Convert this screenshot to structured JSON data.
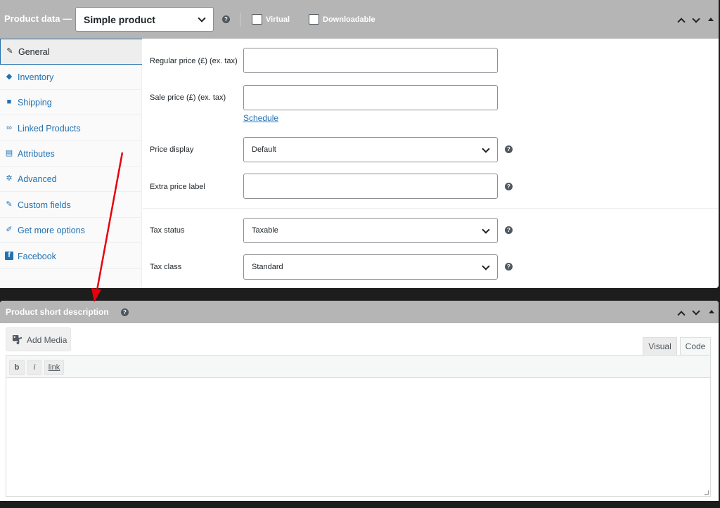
{
  "product_data": {
    "title": "Product data —",
    "type_select": "Simple product",
    "help": "?",
    "virtual_label": "Virtual",
    "downloadable_label": "Downloadable"
  },
  "tabs": [
    {
      "label": "General",
      "icon": "wrench-icon",
      "glyph": "✎"
    },
    {
      "label": "Inventory",
      "icon": "tag-icon",
      "glyph": "◆"
    },
    {
      "label": "Shipping",
      "icon": "truck-icon",
      "glyph": "■"
    },
    {
      "label": "Linked Products",
      "icon": "link-icon",
      "glyph": "∞"
    },
    {
      "label": "Attributes",
      "icon": "list-icon",
      "glyph": "▤"
    },
    {
      "label": "Advanced",
      "icon": "gear-icon",
      "glyph": "✲"
    },
    {
      "label": "Custom fields",
      "icon": "wrench-icon",
      "glyph": "✎"
    },
    {
      "label": "Get more options",
      "icon": "plugin-icon",
      "glyph": "✐"
    },
    {
      "label": "Facebook",
      "icon": "facebook-icon",
      "glyph": "f"
    }
  ],
  "fields": {
    "regular_price_label": "Regular price (£) (ex. tax)",
    "regular_price_value": "",
    "sale_price_label": "Sale price (£) (ex. tax)",
    "sale_price_value": "",
    "schedule_link": "Schedule",
    "price_display_label": "Price display",
    "price_display_value": "Default",
    "extra_price_label": "Extra price label",
    "extra_price_value": "",
    "tax_status_label": "Tax status",
    "tax_status_value": "Taxable",
    "tax_class_label": "Tax class",
    "tax_class_value": "Standard"
  },
  "short_description": {
    "title": "Product short description",
    "help": "?",
    "add_media": "Add Media",
    "visual_tab": "Visual",
    "code_tab": "Code",
    "quicktags": {
      "bold": "b",
      "italic": "i",
      "link": "link"
    },
    "content": ""
  },
  "colors": {
    "accent": "#2271b1",
    "header_bg": "#b5b5b5",
    "annotation_arrow": "#e8000b"
  }
}
